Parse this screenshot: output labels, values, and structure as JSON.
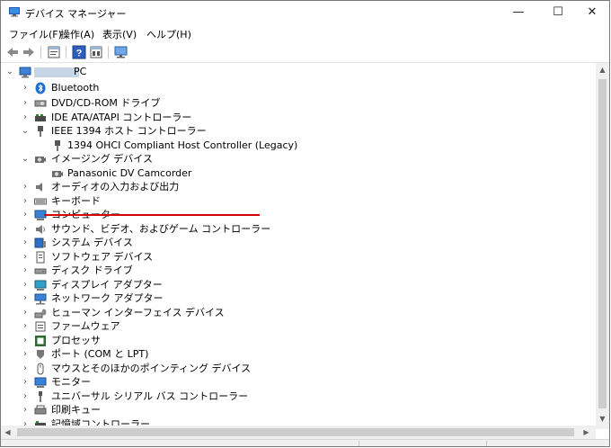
{
  "window": {
    "title": "デバイス マネージャー",
    "controls": {
      "minimize": "—",
      "maximize": "☐",
      "close": "✕"
    }
  },
  "menu": [
    "ファイル(F)",
    "操作(A)",
    "表示(V)",
    "ヘルプ(H)"
  ],
  "toolbar": {
    "icons": [
      "back-arrow-icon",
      "forward-arrow-icon",
      "properties-icon",
      "help-icon",
      "update-driver-icon",
      "scan-hardware-icon"
    ]
  },
  "tree": {
    "root": {
      "label": "PC",
      "expander": "⌄"
    },
    "items": [
      {
        "label": "Bluetooth",
        "expander": "›",
        "icon": "bluetooth-icon"
      },
      {
        "label": "DVD/CD-ROM ドライブ",
        "expander": "›",
        "icon": "dvd-drive-icon"
      },
      {
        "label": "IDE ATA/ATAPI コントローラー",
        "expander": "›",
        "icon": "ide-controller-icon"
      },
      {
        "label": "IEEE 1394 ホスト コントローラー",
        "expander": "⌄",
        "icon": "ieee1394-icon"
      },
      {
        "label": "1394 OHCI Compliant Host Controller (Legacy)",
        "expander": "",
        "icon": "ieee1394-device-icon",
        "child": true
      },
      {
        "label": "イメージング デバイス",
        "expander": "⌄",
        "icon": "imaging-device-icon"
      },
      {
        "label": "Panasonic DV Camcorder",
        "expander": "",
        "icon": "camcorder-icon",
        "child": true
      },
      {
        "label": "オーディオの入力および出力",
        "expander": "›",
        "icon": "audio-io-icon"
      },
      {
        "label": "キーボード",
        "expander": "›",
        "icon": "keyboard-icon"
      },
      {
        "label": "コンピューター",
        "expander": "›",
        "icon": "computer-icon"
      },
      {
        "label": "サウンド、ビデオ、およびゲーム コントローラー",
        "expander": "›",
        "icon": "sound-video-icon"
      },
      {
        "label": "システム デバイス",
        "expander": "›",
        "icon": "system-device-icon"
      },
      {
        "label": "ソフトウェア デバイス",
        "expander": "›",
        "icon": "software-device-icon"
      },
      {
        "label": "ディスク ドライブ",
        "expander": "›",
        "icon": "disk-drive-icon"
      },
      {
        "label": "ディスプレイ アダプター",
        "expander": "›",
        "icon": "display-adapter-icon"
      },
      {
        "label": "ネットワーク アダプター",
        "expander": "›",
        "icon": "network-adapter-icon"
      },
      {
        "label": "ヒューマン インターフェイス デバイス",
        "expander": "›",
        "icon": "hid-icon"
      },
      {
        "label": "ファームウェア",
        "expander": "›",
        "icon": "firmware-icon"
      },
      {
        "label": "プロセッサ",
        "expander": "›",
        "icon": "processor-icon"
      },
      {
        "label": "ポート (COM と LPT)",
        "expander": "›",
        "icon": "port-icon"
      },
      {
        "label": "マウスとそのほかのポインティング デバイス",
        "expander": "›",
        "icon": "mouse-icon"
      },
      {
        "label": "モニター",
        "expander": "›",
        "icon": "monitor-icon"
      },
      {
        "label": "ユニバーサル シリアル バス コントローラー",
        "expander": "›",
        "icon": "usb-icon"
      },
      {
        "label": "印刷キュー",
        "expander": "›",
        "icon": "print-queue-icon"
      },
      {
        "label": "記憶域コントローラー",
        "expander": "›",
        "icon": "storage-controller-icon"
      }
    ]
  },
  "scroll": {
    "up": "▲",
    "down": "▼",
    "left": "◀",
    "right": "▶"
  },
  "colors": {
    "highlight_underline": "#d60000",
    "accent_blue": "#1f6fd1"
  }
}
